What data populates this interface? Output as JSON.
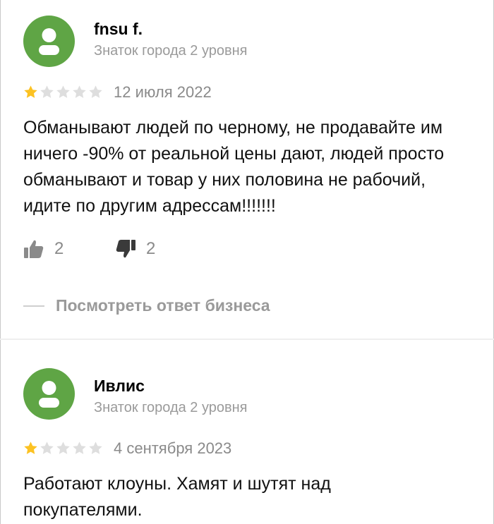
{
  "reviews": [
    {
      "author": "fnsu f.",
      "level": "Знаток города 2 уровня",
      "rating": 1,
      "date": "12 июля 2022",
      "text": "Обманывают людей по черному, не продавайте им ничего -90% от реальной цены дают, людей просто обманывают и товар у них половина не рабочий, идите по другим адрессам!!!!!!!",
      "likes": "2",
      "dislikes": "2",
      "business_reply_label": "Посмотреть ответ бизнеса"
    },
    {
      "author": "Ивлис",
      "level": "Знаток города 2 уровня",
      "rating": 1,
      "date": "4 сентября 2023",
      "text": "Работают клоуны. Хамят и шутят над покупателями."
    }
  ],
  "colors": {
    "avatar": "#5fa545",
    "star_filled": "#fcc222",
    "star_empty": "#dedede",
    "secondary_text": "#9a9a9a"
  },
  "icons": [
    "user-icon",
    "star-icon",
    "thumbs-up-icon",
    "thumbs-down-icon"
  ]
}
